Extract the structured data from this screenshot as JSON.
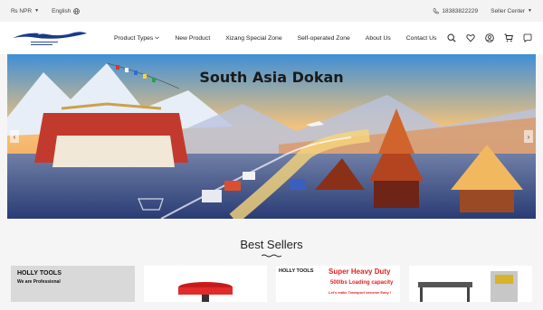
{
  "topbar": {
    "currency": "₨ NPR",
    "language": "English",
    "phone": "18383822229",
    "seller_center": "Seller Center"
  },
  "logo": {
    "name": "Lhasa South Asia Cross-border E-commerce Platform"
  },
  "nav": {
    "items": [
      {
        "label": "Product Types"
      },
      {
        "label": "New Product"
      },
      {
        "label": "Xizang Special Zone"
      },
      {
        "label": "Self-operated Zone"
      },
      {
        "label": "About Us"
      },
      {
        "label": "Contact Us"
      }
    ],
    "icons": [
      "search-icon",
      "heart-icon",
      "user-icon",
      "cart-icon",
      "chat-icon"
    ]
  },
  "banner": {
    "title": "South Asia Dokan"
  },
  "best_sellers": {
    "title": "Best Sellers",
    "cards": [
      {
        "line1": "HOLLY TOOLS",
        "line2": "We are Professional"
      },
      {
        "line1": ""
      },
      {
        "brand": "HOLLY TOOLS",
        "headline": "Super Heavy Duty",
        "capacity": "500lbs Loading capacity",
        "tagline": "Let's make Transport become Easy !"
      },
      {
        "line1": ""
      }
    ]
  },
  "colors": {
    "accent_red": "#e32020",
    "brand_blue": "#1a3a8a"
  }
}
